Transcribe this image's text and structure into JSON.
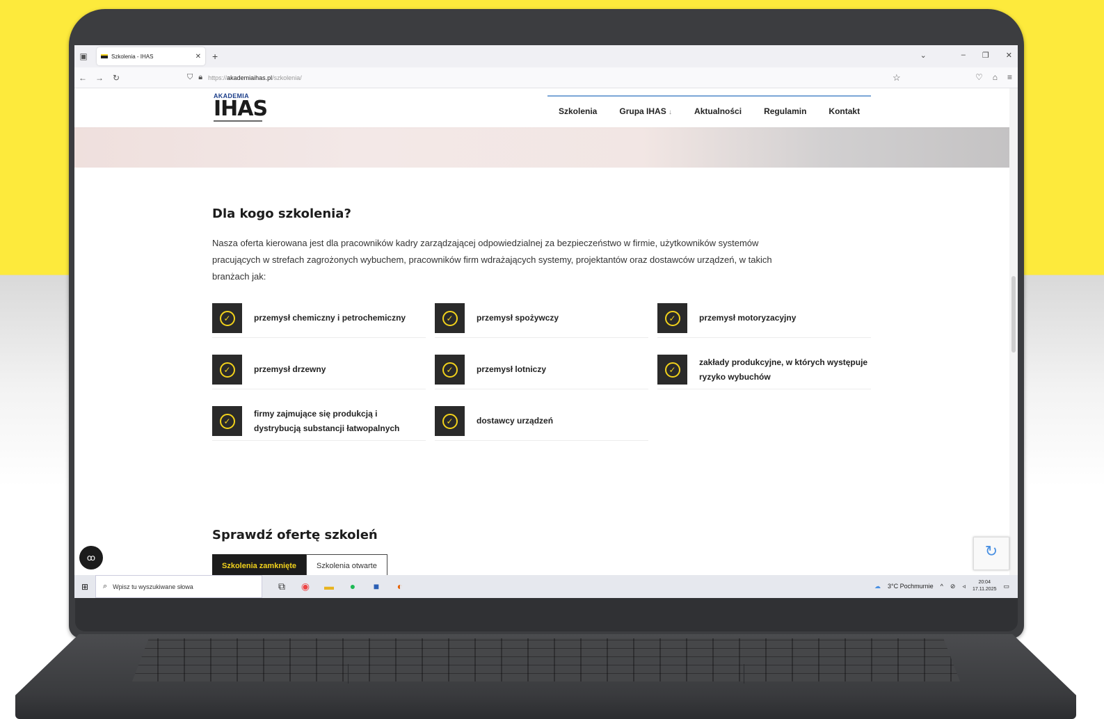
{
  "browser": {
    "tab_title": "Szkolenia - IHAS",
    "url_prefix": "https://",
    "url_domain": "akademiaihas.pl",
    "url_path": "/szkolenia/"
  },
  "site": {
    "logo_top": "AKADEMIA",
    "logo_main": "IHAS",
    "menu": [
      "Szkolenia",
      "Grupa IHAS",
      "Aktualności",
      "Regulamin",
      "Kontakt"
    ],
    "menu_dropdown_marker": "↓"
  },
  "section": {
    "title": "Dla kogo szkolenia?",
    "intro": "Nasza oferta kierowana jest dla pracowników kadry zarządzającej odpowiedzialnej za bezpieczeństwo w firmie, użytkowników systemów pracujących w strefach zagrożonych wybuchem, pracowników firm wdrażających systemy, projektantów oraz dostawców urządzeń, w takich branżach jak:",
    "industries": [
      "przemysł chemiczny i petrochemiczny",
      "przemysł spożywczy",
      "przemysł motoryzacyjny",
      "przemysł drzewny",
      "przemysł lotniczy",
      "zakłady produkcyjne, w których występuje ryzyko wybuchów",
      "firmy zajmujące się produkcją i dystrybucją substancji łatwopalnych",
      "dostawcy urządzeń"
    ]
  },
  "offer": {
    "title": "Sprawdź ofertę szkoleń",
    "tab_closed": "Szkolenia zamknięte",
    "tab_open": "Szkolenia otwarte"
  },
  "taskbar": {
    "search_placeholder": "Wpisz tu wyszukiwane słowa",
    "weather": "3°C Pochmurnie",
    "time": "20:04",
    "date": "17.11.2025"
  },
  "colors": {
    "background_yellow": "#fdea3c",
    "accent_yellow": "#f2d21b",
    "check_box": "#2a2a2a"
  }
}
